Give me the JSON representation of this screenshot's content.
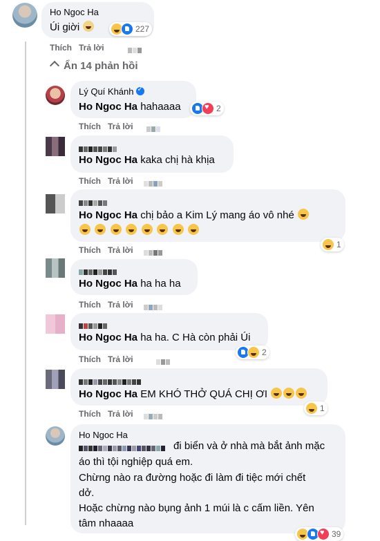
{
  "top_comment": {
    "author": "Ho Ngoc Ha",
    "text": "Úi giời",
    "reaction_count": "227",
    "like_label": "Thích",
    "reply_label": "Trả lời"
  },
  "hide_replies": {
    "label": "Ẩn 14 phản hồi"
  },
  "replies": [
    {
      "author": "Lý Quí Khánh",
      "tag": "Ho Ngoc Ha",
      "text": "hahaaaa",
      "reaction_count": "2"
    },
    {
      "tag": "Ho Ngoc Ha",
      "text": "kaka chị hà khịa"
    },
    {
      "tag": "Ho Ngoc Ha",
      "text": "chị bảo a Kim Lý mang áo vô nhé",
      "reaction_count": "1"
    },
    {
      "tag": "Ho Ngoc Ha",
      "text": "ha ha ha"
    },
    {
      "tag": "Ho Ngoc Ha",
      "text": "ha ha. C Hà còn phải Úi",
      "reaction_count": "2"
    },
    {
      "tag": "Ho Ngoc Ha",
      "text": "EM KHÓ THỞ QUÁ CHỊ ƠI",
      "reaction_count": "1"
    },
    {
      "author": "Ho Ngoc Ha",
      "text_line1": "đi biển và ở nhà mà bắt ảnh mặc",
      "text_line2": "áo thì tội nghiệp quá em.",
      "text_line3": "Chừng nào ra đường hoặc đi làm đi tiệc mới chết",
      "text_line4": "dở.",
      "text_line5": "Hoặc chừng nào bụng ảnh 1 múi là c cấm liền. Yên",
      "text_line6": "tâm nhaaaa",
      "reaction_count": "39"
    }
  ],
  "labels": {
    "like": "Thích",
    "reply": "Trả lời"
  },
  "colors": {
    "bubble": "#f0f2f5",
    "meta": "#65676b",
    "like_blue": "#1877f2"
  }
}
